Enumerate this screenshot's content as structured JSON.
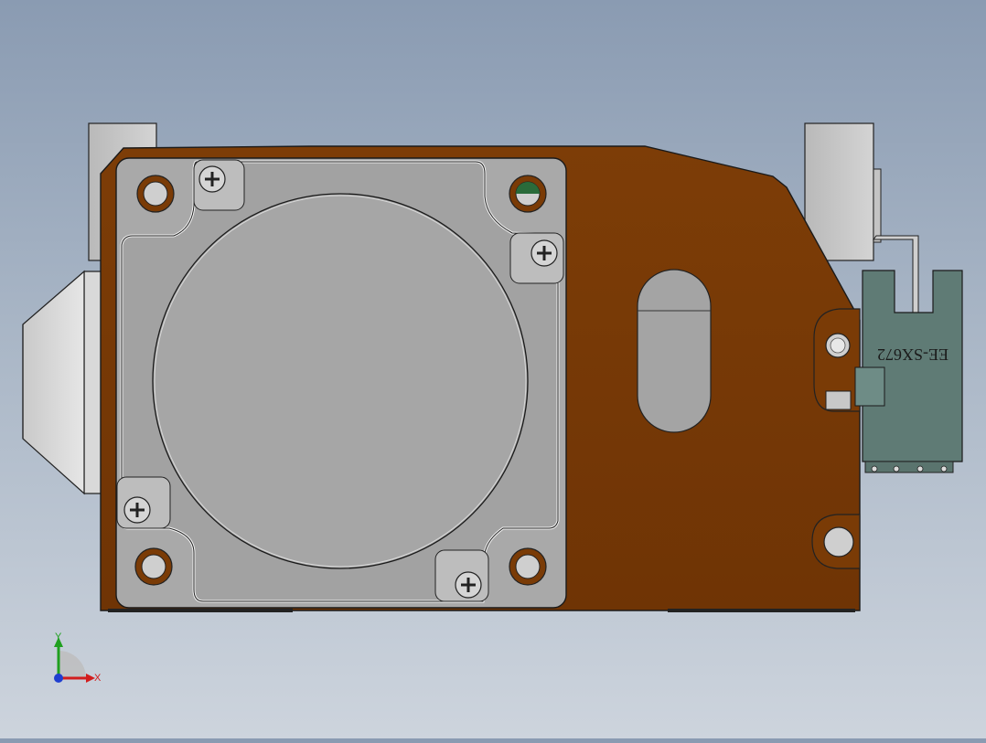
{
  "viewport": {
    "background_top": "#8a9bb2",
    "background_bottom": "#cdd4dd"
  },
  "model": {
    "plate_color": "#7a3b06",
    "motor_color": "#a7a7a7",
    "sensor_color": "#5e7a74",
    "sensor_label": "EE-SX672"
  },
  "triad": {
    "y_label": "Y",
    "x_label": "X",
    "y_color": "#1fa01f",
    "x_color": "#d21d1d",
    "z_color": "#1f3fd0"
  }
}
